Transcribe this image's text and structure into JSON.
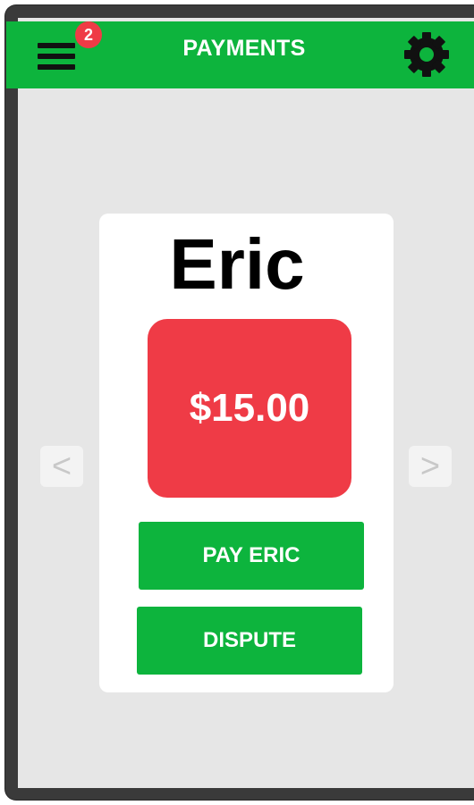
{
  "header": {
    "title": "PAYMENTS",
    "menu_badge_count": "2"
  },
  "payment_card": {
    "name": "Eric",
    "amount": "$15.00",
    "pay_label": "PAY ERIC",
    "dispute_label": "DISPUTE"
  },
  "navigation": {
    "prev_label": "<",
    "next_label": ">"
  },
  "colors": {
    "header_green": "#0db43d",
    "amount_red": "#ef3b46",
    "screen_bg": "#e6e6e6"
  },
  "icons": {
    "menu": "hamburger-menu-icon",
    "settings": "gear-icon"
  }
}
